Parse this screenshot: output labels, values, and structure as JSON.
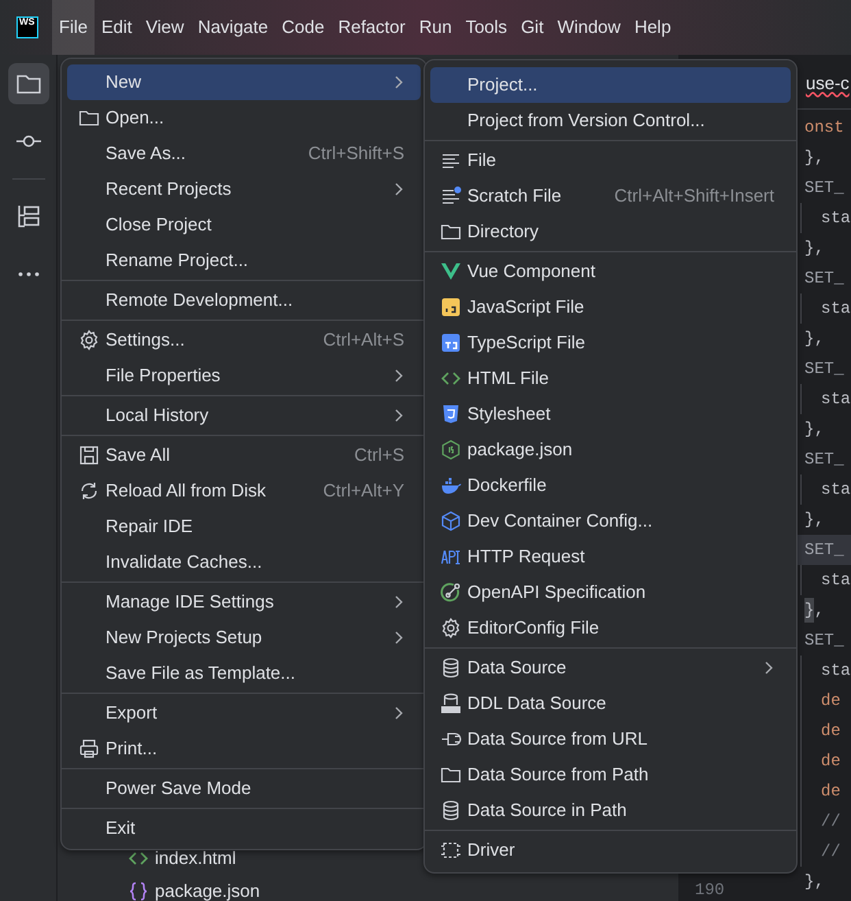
{
  "logo": "WS",
  "menubar": [
    {
      "label": "File",
      "selected": true
    },
    {
      "label": "Edit",
      "selected": false
    },
    {
      "label": "View",
      "selected": false
    },
    {
      "label": "Navigate",
      "selected": false
    },
    {
      "label": "Code",
      "selected": false
    },
    {
      "label": "Refactor",
      "selected": false
    },
    {
      "label": "Run",
      "selected": false
    },
    {
      "label": "Tools",
      "selected": false
    },
    {
      "label": "Git",
      "selected": false
    },
    {
      "label": "Window",
      "selected": false
    },
    {
      "label": "Help",
      "selected": false
    }
  ],
  "tool_strip": [
    {
      "selected": true
    },
    {
      "selected": false
    },
    {
      "selected": false
    },
    {
      "selected": false
    }
  ],
  "project_tree": [
    {
      "label": "index.html",
      "kind": "html"
    },
    {
      "label": "package.json",
      "kind": "json"
    }
  ],
  "gutter": {
    "line_number": "190"
  },
  "editor_tab": {
    "label": "use-c"
  },
  "code_lines": [
    {
      "indented": false,
      "current": false,
      "tokens": [
        {
          "text": "onst",
          "kind": "keyword"
        }
      ]
    },
    {
      "indented": false,
      "current": false,
      "tokens": [
        {
          "text": "},",
          "kind": "plain"
        }
      ]
    },
    {
      "indented": false,
      "current": false,
      "tokens": [
        {
          "text": "SET_",
          "kind": "key"
        }
      ]
    },
    {
      "indented": true,
      "current": false,
      "tokens": [
        {
          "text": "sta",
          "kind": "plain"
        }
      ]
    },
    {
      "indented": false,
      "current": false,
      "tokens": [
        {
          "text": "},",
          "kind": "plain"
        }
      ]
    },
    {
      "indented": false,
      "current": false,
      "tokens": [
        {
          "text": "SET_",
          "kind": "key"
        }
      ]
    },
    {
      "indented": true,
      "current": false,
      "tokens": [
        {
          "text": "sta",
          "kind": "plain"
        }
      ]
    },
    {
      "indented": false,
      "current": false,
      "tokens": [
        {
          "text": "},",
          "kind": "plain"
        }
      ]
    },
    {
      "indented": false,
      "current": false,
      "tokens": [
        {
          "text": "SET_",
          "kind": "key"
        }
      ]
    },
    {
      "indented": true,
      "current": false,
      "tokens": [
        {
          "text": "sta",
          "kind": "plain"
        }
      ]
    },
    {
      "indented": false,
      "current": false,
      "tokens": [
        {
          "text": "},",
          "kind": "plain"
        }
      ]
    },
    {
      "indented": false,
      "current": false,
      "tokens": [
        {
          "text": "SET_",
          "kind": "key"
        }
      ]
    },
    {
      "indented": true,
      "current": false,
      "tokens": [
        {
          "text": "sta",
          "kind": "plain"
        }
      ]
    },
    {
      "indented": false,
      "current": false,
      "tokens": [
        {
          "text": "},",
          "kind": "plain"
        }
      ]
    },
    {
      "indented": false,
      "current": true,
      "tokens": [
        {
          "text": "SET_",
          "kind": "key"
        }
      ]
    },
    {
      "indented": true,
      "current": false,
      "tokens": [
        {
          "text": "sta",
          "kind": "plain"
        }
      ]
    },
    {
      "indented": false,
      "current": false,
      "tokens": [
        {
          "text": "}",
          "kind": "brace_match"
        },
        {
          "text": ",",
          "kind": "plain"
        }
      ]
    },
    {
      "indented": false,
      "current": false,
      "tokens": [
        {
          "text": "SET_",
          "kind": "key"
        }
      ]
    },
    {
      "indented": true,
      "current": false,
      "tokens": [
        {
          "text": "sta",
          "kind": "plain"
        }
      ]
    },
    {
      "indented": true,
      "current": false,
      "tokens": [
        {
          "text": "de",
          "kind": "keyword"
        }
      ]
    },
    {
      "indented": true,
      "current": false,
      "tokens": [
        {
          "text": "de",
          "kind": "keyword"
        }
      ]
    },
    {
      "indented": true,
      "current": false,
      "tokens": [
        {
          "text": "de",
          "kind": "keyword"
        }
      ]
    },
    {
      "indented": true,
      "current": false,
      "tokens": [
        {
          "text": "de",
          "kind": "keyword"
        }
      ]
    },
    {
      "indented": true,
      "current": false,
      "tokens": [
        {
          "text": "//",
          "kind": "comment"
        }
      ]
    },
    {
      "indented": true,
      "current": false,
      "tokens": [
        {
          "text": "//",
          "kind": "comment"
        }
      ]
    },
    {
      "indented": false,
      "current": false,
      "tokens": [
        {
          "text": "},",
          "kind": "plain"
        }
      ]
    }
  ],
  "file_menu": [
    [
      {
        "label": "New",
        "has_submenu": true,
        "selected": true
      },
      {
        "label": "Open...",
        "has_submenu": false,
        "selected": false
      },
      {
        "label": "Save As...",
        "shortcut": "Ctrl+Shift+S",
        "has_submenu": false,
        "selected": false
      },
      {
        "label": "Recent Projects",
        "has_submenu": true,
        "selected": false
      },
      {
        "label": "Close Project",
        "has_submenu": false,
        "selected": false
      },
      {
        "label": "Rename Project...",
        "has_submenu": false,
        "selected": false
      }
    ],
    [
      {
        "label": "Remote Development...",
        "has_submenu": false,
        "selected": false
      }
    ],
    [
      {
        "label": "Settings...",
        "shortcut": "Ctrl+Alt+S",
        "has_submenu": false,
        "selected": false
      },
      {
        "label": "File Properties",
        "has_submenu": true,
        "selected": false
      }
    ],
    [
      {
        "label": "Local History",
        "has_submenu": true,
        "selected": false
      }
    ],
    [
      {
        "label": "Save All",
        "shortcut": "Ctrl+S",
        "has_submenu": false,
        "selected": false
      },
      {
        "label": "Reload All from Disk",
        "shortcut": "Ctrl+Alt+Y",
        "has_submenu": false,
        "selected": false
      },
      {
        "label": "Repair IDE",
        "has_submenu": false,
        "selected": false
      },
      {
        "label": "Invalidate Caches...",
        "has_submenu": false,
        "selected": false
      }
    ],
    [
      {
        "label": "Manage IDE Settings",
        "has_submenu": true,
        "selected": false
      },
      {
        "label": "New Projects Setup",
        "has_submenu": true,
        "selected": false
      },
      {
        "label": "Save File as Template...",
        "has_submenu": false,
        "selected": false
      }
    ],
    [
      {
        "label": "Export",
        "has_submenu": true,
        "selected": false
      },
      {
        "label": "Print...",
        "has_submenu": false,
        "selected": false
      }
    ],
    [
      {
        "label": "Power Save Mode",
        "has_submenu": false,
        "selected": false
      }
    ],
    [
      {
        "label": "Exit",
        "has_submenu": false,
        "selected": false
      }
    ]
  ],
  "new_submenu": [
    [
      {
        "label": "Project...",
        "has_submenu": false,
        "selected": true
      },
      {
        "label": "Project from Version Control...",
        "has_submenu": false,
        "selected": false
      }
    ],
    [
      {
        "label": "File",
        "has_submenu": false,
        "selected": false
      },
      {
        "label": "Scratch File",
        "shortcut": "Ctrl+Alt+Shift+Insert",
        "has_submenu": false,
        "selected": false
      },
      {
        "label": "Directory",
        "has_submenu": false,
        "selected": false
      }
    ],
    [
      {
        "label": "Vue Component",
        "has_submenu": false,
        "selected": false
      },
      {
        "label": "JavaScript File",
        "has_submenu": false,
        "selected": false
      },
      {
        "label": "TypeScript File",
        "has_submenu": false,
        "selected": false
      },
      {
        "label": "HTML File",
        "has_submenu": false,
        "selected": false
      },
      {
        "label": "Stylesheet",
        "has_submenu": false,
        "selected": false
      },
      {
        "label": "package.json",
        "has_submenu": false,
        "selected": false
      },
      {
        "label": "Dockerfile",
        "has_submenu": false,
        "selected": false
      },
      {
        "label": "Dev Container Config...",
        "has_submenu": false,
        "selected": false
      },
      {
        "label": "HTTP Request",
        "has_submenu": false,
        "selected": false
      },
      {
        "label": "OpenAPI Specification",
        "has_submenu": false,
        "selected": false
      },
      {
        "label": "EditorConfig File",
        "has_submenu": false,
        "selected": false
      }
    ],
    [
      {
        "label": "Data Source",
        "has_submenu": true,
        "selected": false
      },
      {
        "label": "DDL Data Source",
        "has_submenu": false,
        "selected": false
      },
      {
        "label": "Data Source from URL",
        "has_submenu": false,
        "selected": false
      },
      {
        "label": "Data Source from Path",
        "has_submenu": false,
        "selected": false
      },
      {
        "label": "Data Source in Path",
        "has_submenu": false,
        "selected": false
      }
    ],
    [
      {
        "label": "Driver",
        "has_submenu": false,
        "selected": false
      }
    ]
  ]
}
